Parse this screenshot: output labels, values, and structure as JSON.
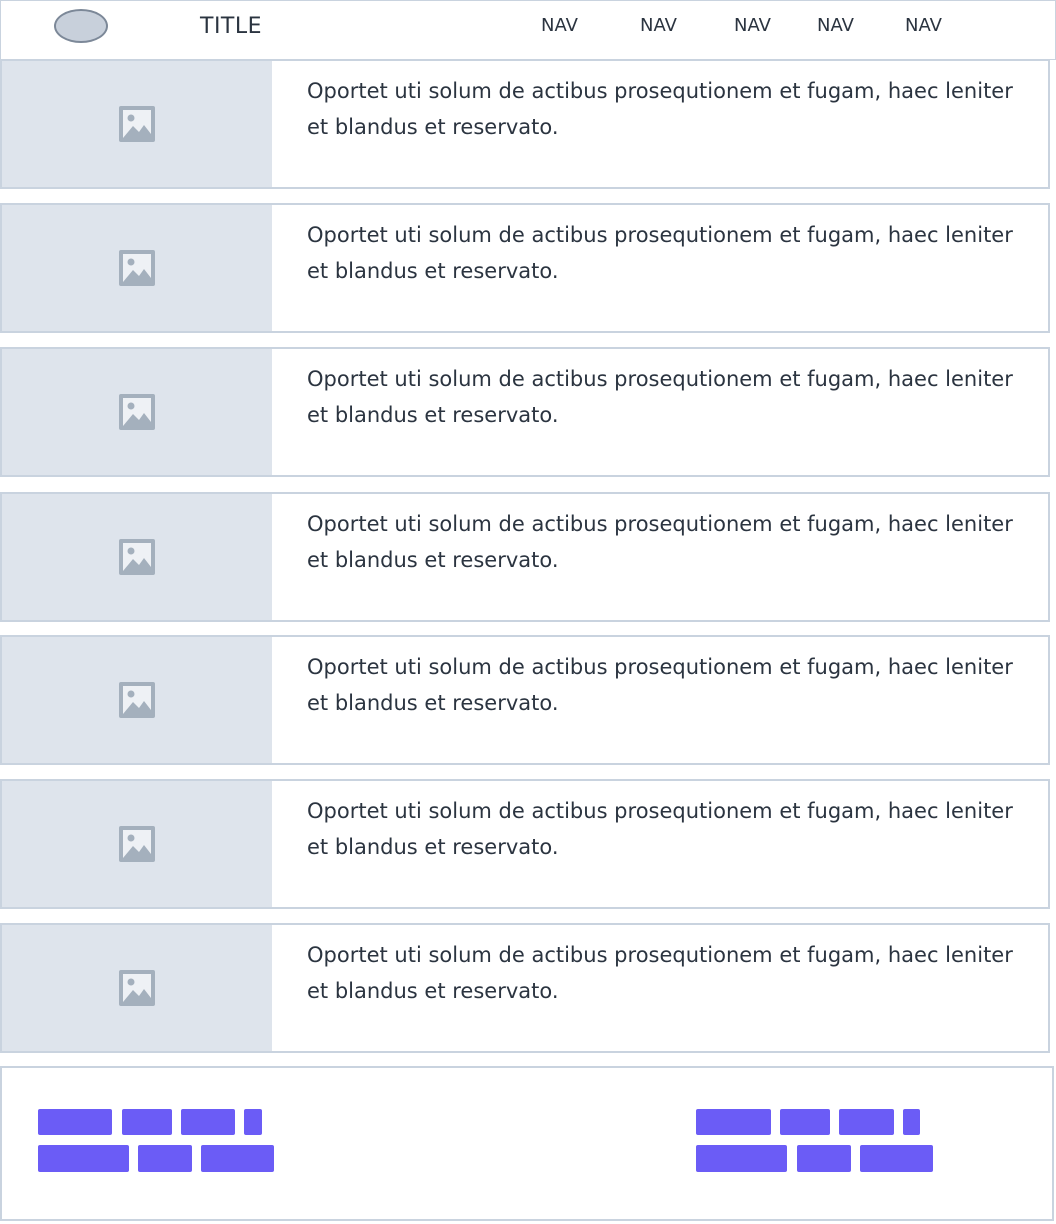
{
  "header": {
    "title": "TITLE",
    "nav": [
      "NAV",
      "NAV",
      "NAV",
      "NAV",
      "NAV"
    ]
  },
  "rows": [
    {
      "text": "Oportet uti solum de actibus prosequtionem et fugam, haec leniter et blandus et reservato."
    },
    {
      "text": "Oportet uti solum de actibus prosequtionem et fugam, haec leniter et blandus et reservato."
    },
    {
      "text": "Oportet uti solum de actibus prosequtionem et fugam, haec leniter et blandus et reservato."
    },
    {
      "text": "Oportet uti solum de actibus prosequtionem et fugam, haec leniter et blandus et reservato."
    },
    {
      "text": "Oportet uti solum de actibus prosequtionem et fugam, haec leniter et blandus et reservato."
    },
    {
      "text": "Oportet uti solum de actibus prosequtionem et fugam, haec leniter et blandus et reservato."
    },
    {
      "text": "Oportet uti solum de actibus prosequtionem et fugam, haec leniter et blandus et reservato."
    }
  ],
  "icons": {
    "logo": "oval-logo-icon",
    "row_thumbnail": "image-placeholder-icon"
  },
  "colors": {
    "border": "#c9d3df",
    "thumb_bg": "#dee4ec",
    "icon": "#a4b0bd",
    "footer_block": "#6b5cf6",
    "text": "#2b3440"
  }
}
